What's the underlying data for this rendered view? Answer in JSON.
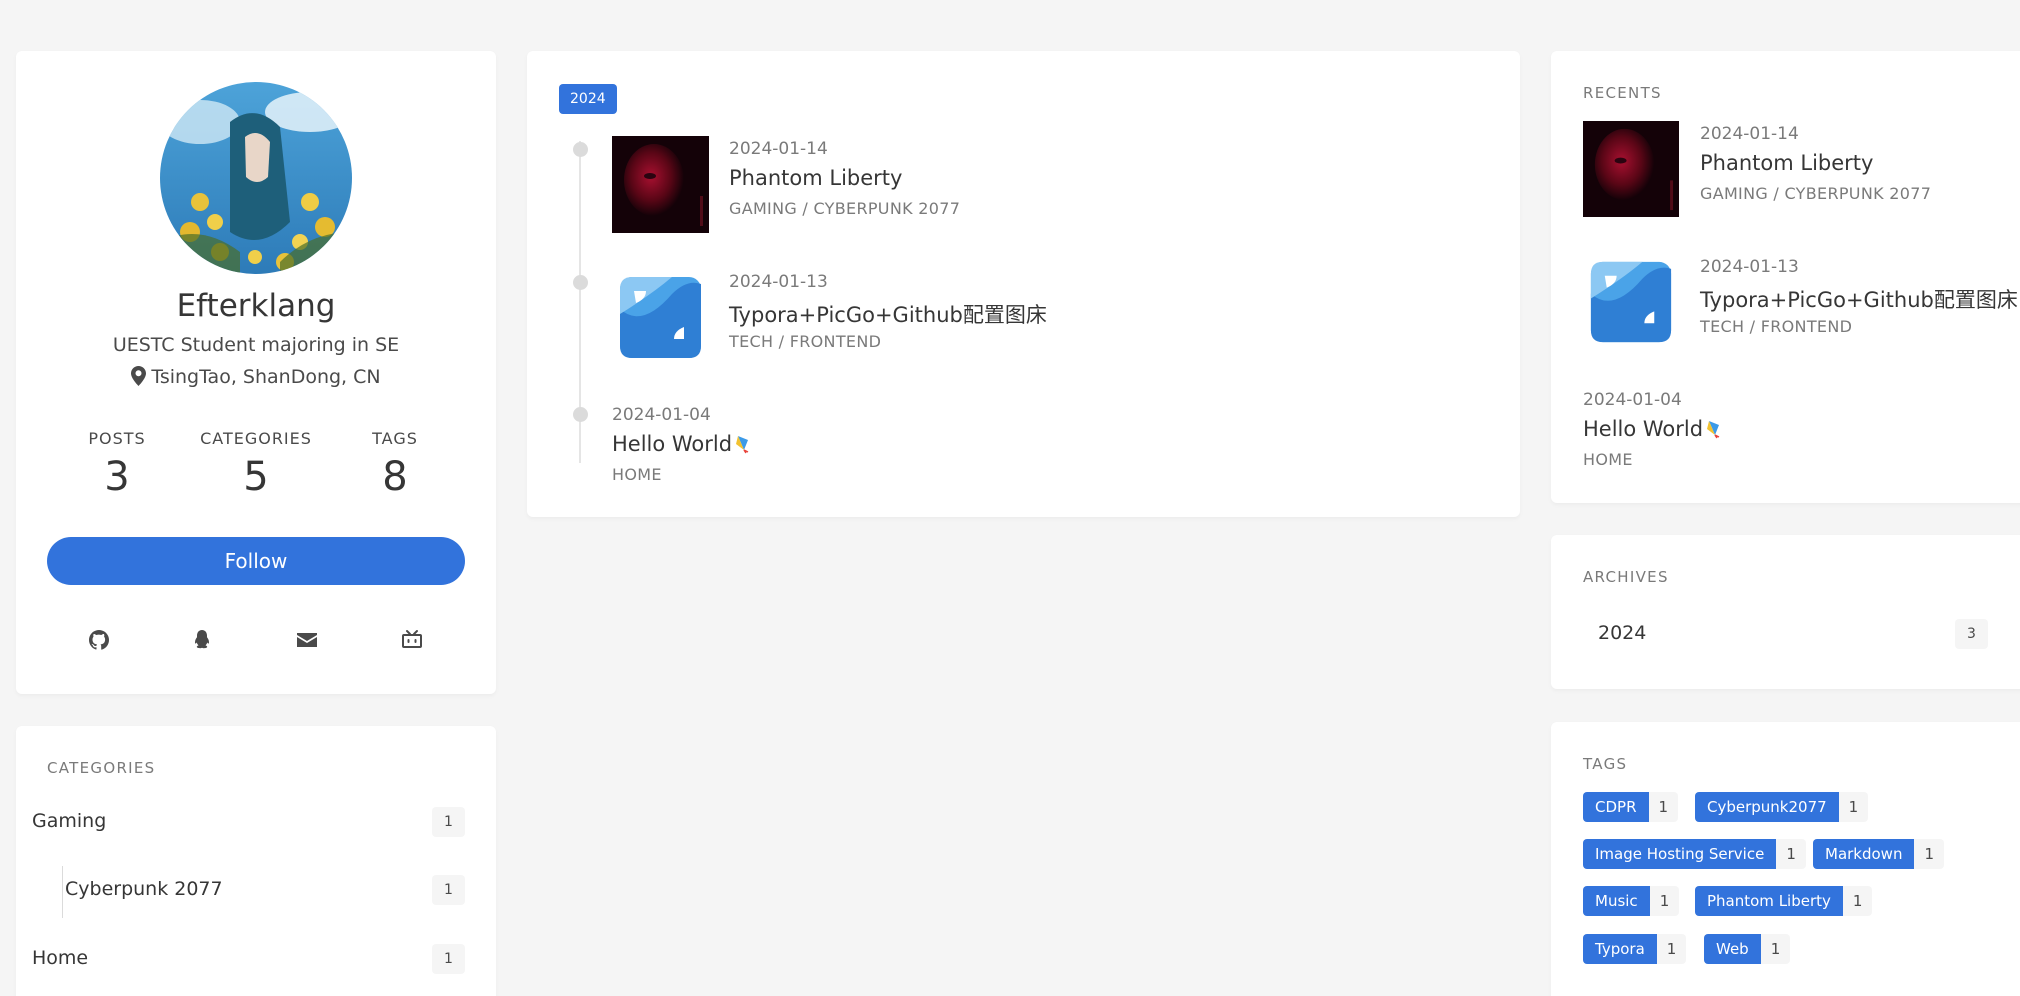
{
  "profile": {
    "name": "Efterklang",
    "bio": "UESTC Student majoring in SE",
    "location": "TsingTao, ShanDong, CN",
    "stats": [
      {
        "label": "POSTS",
        "value": "3"
      },
      {
        "label": "CATEGORIES",
        "value": "5"
      },
      {
        "label": "TAGS",
        "value": "8"
      }
    ],
    "follow_label": "Follow",
    "socials": [
      "github-icon",
      "qq-icon",
      "email-icon",
      "bilibili-icon"
    ]
  },
  "categories": {
    "title": "CATEGORIES",
    "items": [
      {
        "name": "Gaming",
        "count": "1"
      },
      {
        "name": "Cyberpunk 2077",
        "count": "1"
      },
      {
        "name": "Home",
        "count": "1"
      }
    ]
  },
  "timeline": {
    "year": "2024",
    "posts": [
      {
        "date": "2024-01-14",
        "title": "Phantom Liberty",
        "category": "GAMING / CYBERPUNK 2077",
        "thumb": "phantom-liberty-thumbnail"
      },
      {
        "date": "2024-01-13",
        "title": "Typora+PicGo+Github配置图床",
        "category": "TECH / FRONTEND",
        "thumb": "picgo-thumbnail"
      },
      {
        "date": "2024-01-04",
        "title": "Hello World",
        "category": "HOME"
      }
    ]
  },
  "recents": {
    "title": "RECENTS",
    "posts": [
      {
        "date": "2024-01-14",
        "title": "Phantom Liberty",
        "category": "GAMING / CYBERPUNK 2077"
      },
      {
        "date": "2024-01-13",
        "title": "Typora+PicGo+Github配置图床",
        "category": "TECH / FRONTEND"
      },
      {
        "date": "2024-01-04",
        "title": "Hello World",
        "category": "HOME"
      }
    ]
  },
  "archives": {
    "title": "ARCHIVES",
    "items": [
      {
        "name": "2024",
        "count": "3"
      }
    ]
  },
  "tags": {
    "title": "TAGS",
    "items": [
      {
        "name": "CDPR",
        "count": "1"
      },
      {
        "name": "Cyberpunk2077",
        "count": "1"
      },
      {
        "name": "Image Hosting Service",
        "count": "1"
      },
      {
        "name": "Markdown",
        "count": "1"
      },
      {
        "name": "Music",
        "count": "1"
      },
      {
        "name": "Phantom Liberty",
        "count": "1"
      },
      {
        "name": "Typora",
        "count": "1"
      },
      {
        "name": "Web",
        "count": "1"
      }
    ]
  },
  "colors": {
    "accent": "#3273dc",
    "background": "#f5f5f5",
    "text": "#363636",
    "muted": "#7a7a7a"
  }
}
